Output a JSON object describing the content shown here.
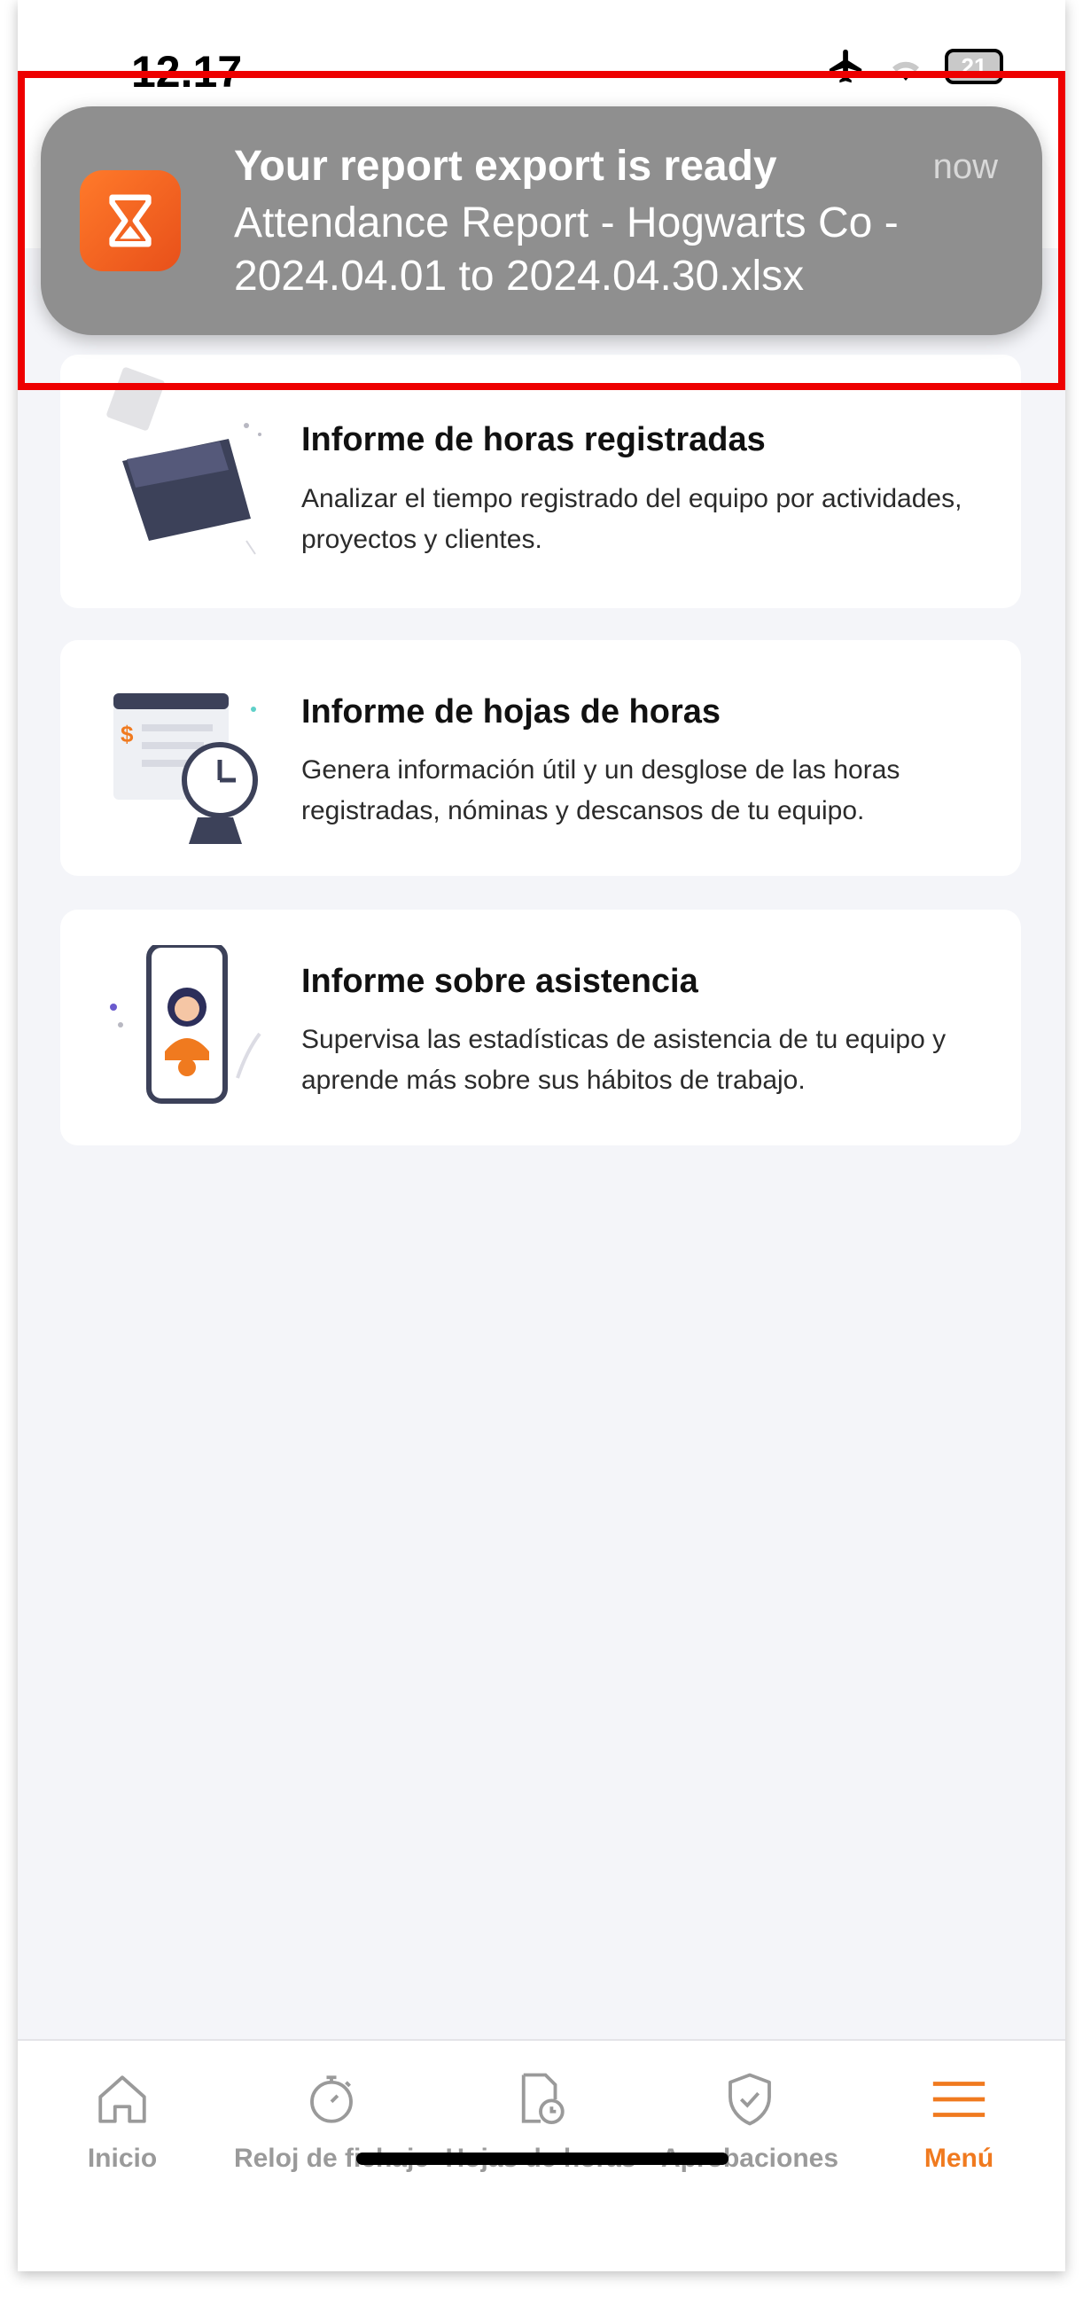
{
  "status_bar": {
    "time": "12.17",
    "battery": "21"
  },
  "notification": {
    "title": "Your report export is ready",
    "time": "now",
    "body": "Attendance Report - Hogwarts Co - 2024.04.01 to 2024.04.30.xlsx",
    "app_icon": "hourglass-icon"
  },
  "reports": [
    {
      "title": "Informe de horas registradas",
      "description": "Analizar el tiempo registrado del equipo por actividades, proyectos y clientes.",
      "icon": "folder-illustration"
    },
    {
      "title": "Informe de hojas de horas",
      "description": "Genera información útil y un desglose de las horas registradas, nóminas y descansos de tu equipo.",
      "icon": "timesheet-clock-illustration"
    },
    {
      "title": "Informe sobre asistencia",
      "description": "Supervisa las estadísticas de asistencia de tu equipo y aprende más sobre sus hábitos de trabajo.",
      "icon": "phone-person-illustration"
    }
  ],
  "bottom_nav": {
    "items": [
      {
        "label": "Inicio",
        "icon": "home-icon"
      },
      {
        "label": "Reloj de fichaje",
        "icon": "stopwatch-icon"
      },
      {
        "label": "Hojas de horas",
        "icon": "timesheet-icon"
      },
      {
        "label": "Aprobaciones",
        "icon": "shield-check-icon"
      },
      {
        "label": "Menú",
        "icon": "hamburger-icon"
      }
    ],
    "active": "Menú"
  },
  "colors": {
    "accent": "#f07a1f",
    "highlight": "#ee0000",
    "notification_bg": "#8f8f8f"
  }
}
